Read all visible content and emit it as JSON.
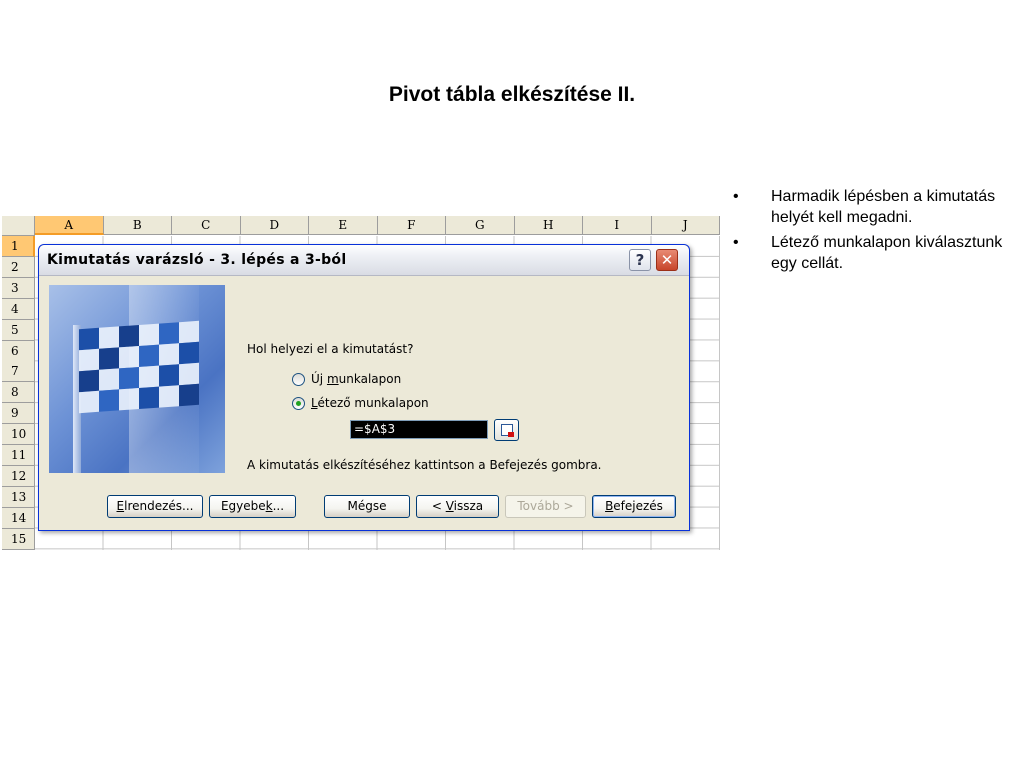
{
  "slide": {
    "title": "Pivot tábla elkészítése II.",
    "bullets": [
      {
        "marker": "•",
        "text": "Harmadik lépésben a kimutatás helyét kell megadni."
      },
      {
        "marker": "•",
        "text": "Létező munkalapon kiválasztunk egy cellát."
      }
    ]
  },
  "sheet": {
    "columns": [
      "A",
      "B",
      "C",
      "D",
      "E",
      "F",
      "G",
      "H",
      "I",
      "J"
    ],
    "rows": [
      "1",
      "2",
      "3",
      "4",
      "5",
      "6",
      "7",
      "8",
      "9",
      "10",
      "11",
      "12",
      "13",
      "14",
      "15"
    ],
    "selected_column": "A",
    "selected_row": "1"
  },
  "dialog": {
    "title": "Kimutatás varázsló - 3. lépés a 3-ból",
    "help_glyph": "?",
    "close_glyph": "✕",
    "question": "Hol helyezi el a kimutatást?",
    "radio_new": {
      "pre": "Új ",
      "accel": "m",
      "post": "unkalapon",
      "checked": false
    },
    "radio_existing": {
      "pre": "",
      "accel": "L",
      "post": "étező munkalapon",
      "checked": true
    },
    "reference_value": "=$A$3",
    "hint": "A kimutatás elkészítéséhez kattintson a Befejezés gombra.",
    "buttons": {
      "layout": {
        "accel": "E",
        "rest": "lrendezés..."
      },
      "options": {
        "pre": "Egyebe",
        "accel": "k",
        "post": "..."
      },
      "cancel": "Mégse",
      "back": {
        "pre": "< ",
        "accel": "V",
        "post": "issza"
      },
      "next": "Tovább >",
      "finish": {
        "accel": "B",
        "rest": "efejezés"
      }
    }
  }
}
